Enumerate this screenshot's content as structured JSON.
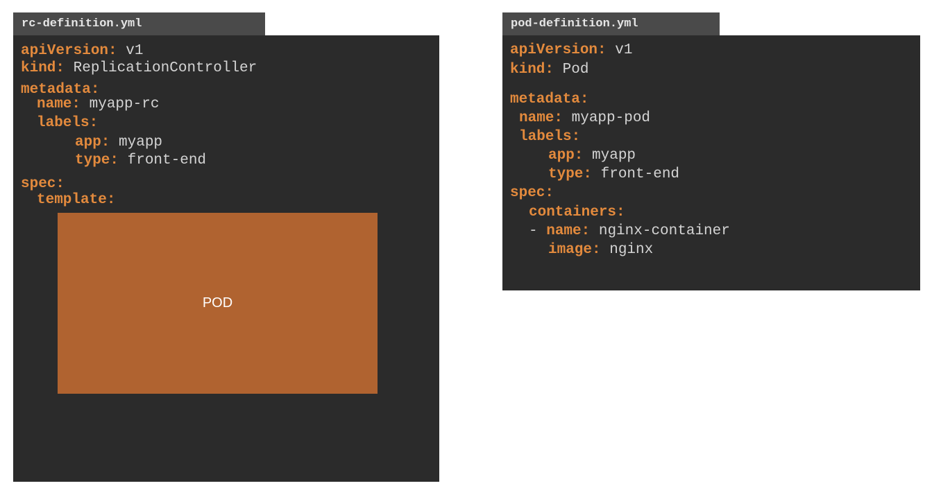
{
  "left": {
    "tab": "rc-definition.yml",
    "lines": [
      {
        "key": "apiVersion:",
        "value": " v1"
      },
      {
        "key": "kind:",
        "value": " ReplicationController"
      },
      {
        "key": "metadata:",
        "value": ""
      },
      {
        "key": "name:",
        "value": " myapp-rc"
      },
      {
        "key": "labels:",
        "value": ""
      },
      {
        "key": "app:",
        "value": " myapp"
      },
      {
        "key": "type:",
        "value": " front-end"
      },
      {
        "key": "spec:",
        "value": ""
      },
      {
        "key": "template:",
        "value": ""
      }
    ],
    "pod_label": "POD"
  },
  "right": {
    "tab": "pod-definition.yml",
    "lines": [
      {
        "key": "apiVersion:",
        "value": " v1"
      },
      {
        "key": "kind:",
        "value": " Pod"
      },
      {
        "key": "metadata:",
        "value": ""
      },
      {
        "key": "name:",
        "value": " myapp-pod"
      },
      {
        "key": "labels:",
        "value": ""
      },
      {
        "key": "app:",
        "value": " myapp"
      },
      {
        "key": "type:",
        "value": " front-end"
      },
      {
        "key": "spec:",
        "value": ""
      },
      {
        "key": "containers:",
        "value": ""
      },
      {
        "prefix": "- ",
        "key": "name:",
        "value": " nginx-container"
      },
      {
        "key": "image:",
        "value": " nginx"
      }
    ]
  },
  "colors": {
    "key": "#e38a3d",
    "value": "#d4d4d4",
    "panel": "#2b2b2b",
    "tab": "#4a4a4a",
    "pod": "#b06330"
  }
}
